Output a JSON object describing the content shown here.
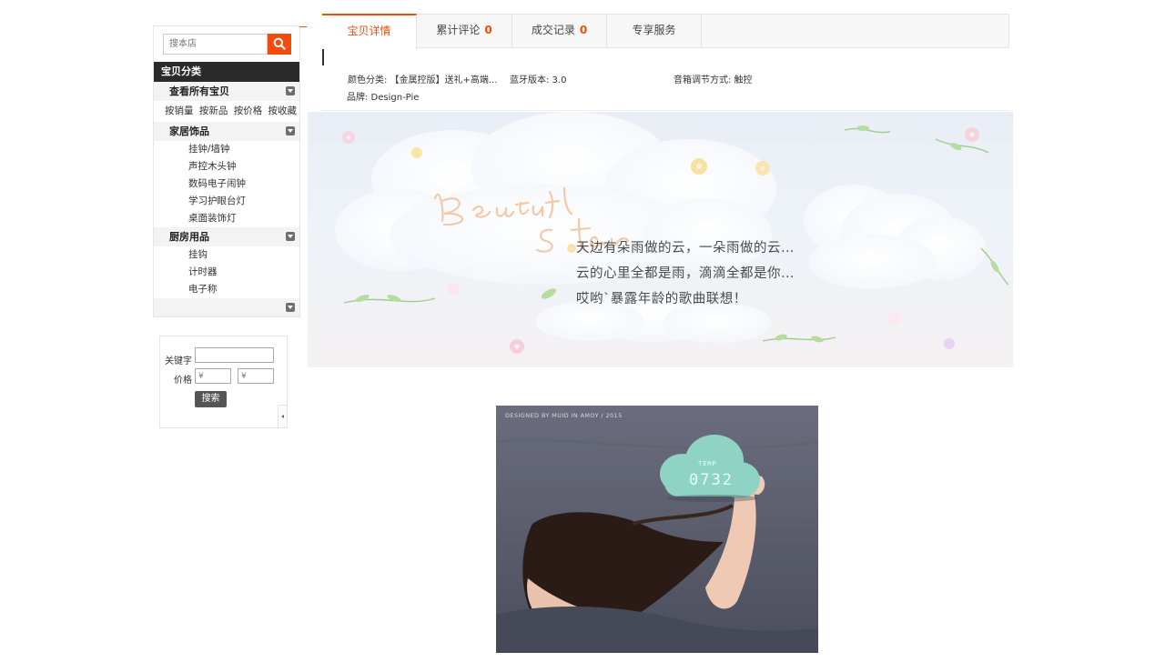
{
  "sidebar": {
    "search": {
      "placeholder": "搜本店",
      "icon": "search-icon"
    },
    "category_title": "宝贝分类",
    "groups": [
      {
        "title": "查看所有宝贝",
        "sorts": [
          "按销量",
          "按新品",
          "按价格",
          "按收藏"
        ]
      },
      {
        "title": "家居饰品",
        "items": [
          "挂钟/墙钟",
          "声控木头钟",
          "数码电子闹钟",
          "学习护眼台灯",
          "桌面装饰灯"
        ]
      },
      {
        "title": "厨房用品",
        "items": [
          "挂钩",
          "计时器",
          "电子称"
        ]
      }
    ],
    "filter": {
      "keyword_label": "关键字",
      "keyword_value": "",
      "price_label": "价格",
      "price_min_placeholder": "¥",
      "price_max_placeholder": "¥",
      "search_label": "搜索"
    }
  },
  "tabs": [
    {
      "label": "宝贝详情",
      "active": true
    },
    {
      "label": "累计评论",
      "count": "0"
    },
    {
      "label": "成交记录",
      "count": "0"
    },
    {
      "label": "专享服务"
    }
  ],
  "attributes": {
    "color": "颜色分类: 【金属控版】送礼+高端...",
    "bluetooth": "蓝牙版本: 3.0",
    "volume": "音箱调节方式: 触控",
    "brand": "品牌: Design-Pie"
  },
  "banner": {
    "script_title": "Beautiful Star",
    "lines": [
      "天边有朵雨做的云，一朵雨做的云…",
      "云的心里全都是雨，滴滴全都是你…",
      "哎哟`暴露年龄的歌曲联想！"
    ]
  },
  "photo": {
    "caption": "DESIGNED BY MUID IN AMOY  /  2015",
    "clock_label": "TEMP",
    "clock_time": "0732"
  },
  "colors": {
    "accent": "#f24b0c",
    "category_header_bg": "#2b2b2b",
    "group_header_bg": "#f3f3f3",
    "clock_body": "#8fd3c4"
  }
}
